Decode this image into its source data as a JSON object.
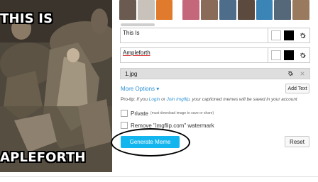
{
  "meme": {
    "top_text": "THIS IS",
    "bottom_text": "APLEFORTH"
  },
  "thumbs": [
    {
      "name": "template-thumb-1",
      "color": "#6a5a50"
    },
    {
      "name": "template-thumb-2",
      "color": "#c9c2bb"
    },
    {
      "name": "template-thumb-3",
      "color": "#e07a2c"
    },
    {
      "name": "template-thumb-4",
      "color": "#c5677a"
    },
    {
      "name": "template-thumb-5",
      "color": "#8a6b59"
    },
    {
      "name": "template-thumb-6",
      "color": "#4e6d8a"
    },
    {
      "name": "template-thumb-7",
      "color": "#5c4a3e"
    },
    {
      "name": "template-thumb-8",
      "color": "#3a84b6"
    },
    {
      "name": "template-thumb-9",
      "color": "#55687a"
    },
    {
      "name": "template-thumb-10",
      "color": "#9a7a5e"
    }
  ],
  "text_boxes": [
    {
      "value": "This Is"
    },
    {
      "value": "Ampleforth"
    }
  ],
  "image_row": {
    "filename": "1.jpg"
  },
  "options": {
    "more_options": "More Options ▾",
    "add_text": "Add Text"
  },
  "protip": {
    "label": "Pro-tip:",
    "prefix": " If you ",
    "login": "Login",
    "or": " or ",
    "join": "Join Imgflip",
    "suffix": ", your captioned memes will be saved in your account"
  },
  "checkboxes": {
    "private_label": "Private",
    "private_note": "(must download image to save or share)",
    "watermark_label": "Remove \"imgflip.com\" watermark"
  },
  "buttons": {
    "generate": "Generate Meme",
    "reset": "Reset"
  },
  "colors": {
    "accent": "#13b5ee",
    "link": "#2b8fd6"
  }
}
